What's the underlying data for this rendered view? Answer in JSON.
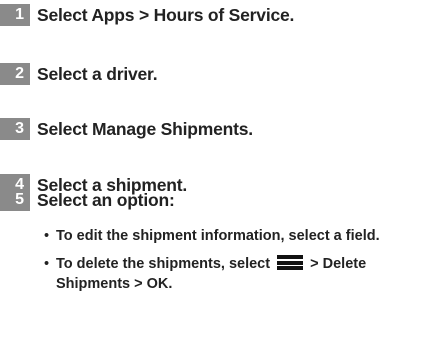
{
  "steps": [
    {
      "number": "1",
      "text": "Select Apps > Hours of Service."
    },
    {
      "number": "2",
      "text": "Select a driver."
    },
    {
      "number": "3",
      "text": "Select Manage Shipments."
    },
    {
      "number": "4",
      "text": "Select a shipment."
    },
    {
      "number": "5",
      "text": "Select an option:"
    }
  ],
  "options": {
    "bullet_symbol": "•",
    "edit": "To edit the shipment information, select a field.",
    "delete_before_icon": "To delete the shipments, select",
    "delete_icon": "menu-icon",
    "delete_after_icon": "> Delete Shipments > OK."
  },
  "colors": {
    "badge_background": "#8a8a8a",
    "badge_text": "#ffffff",
    "text": "#222222"
  }
}
